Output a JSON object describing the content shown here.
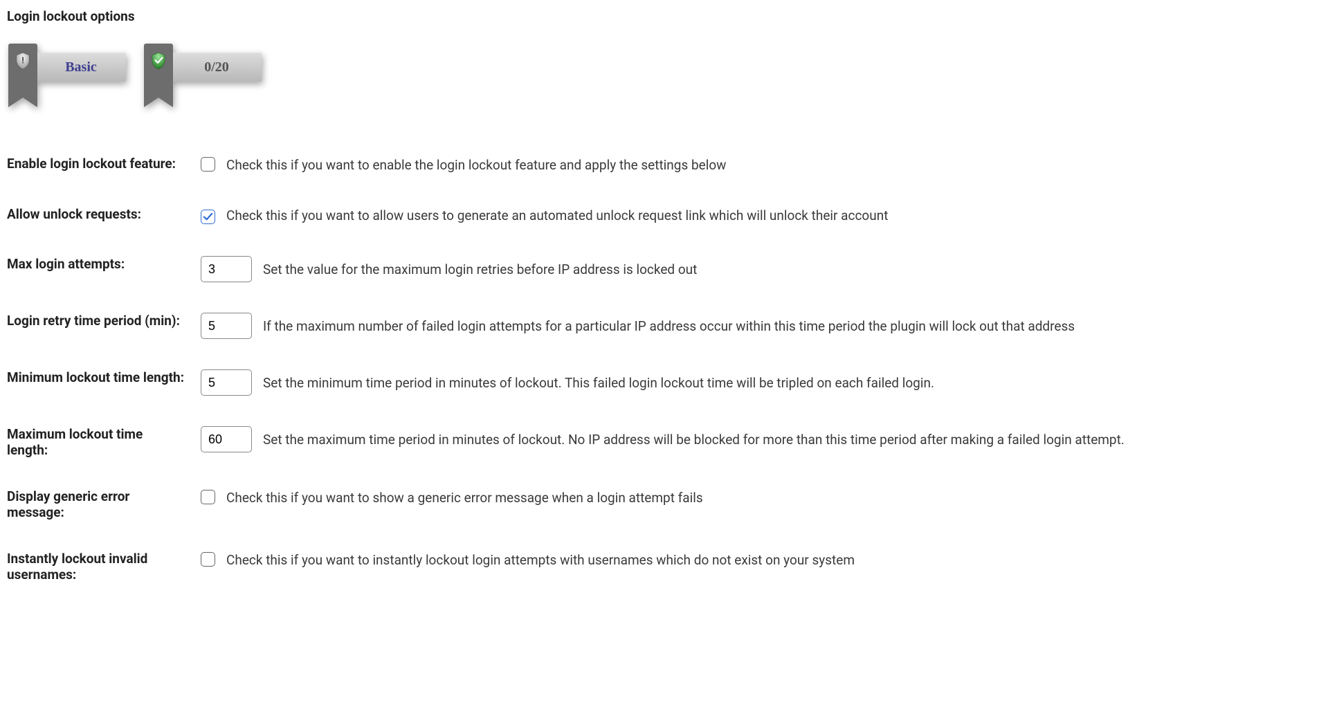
{
  "title": "Login lockout options",
  "badges": {
    "basic": "Basic",
    "score": "0/20"
  },
  "rows": {
    "enable": {
      "label": "Enable login lockout feature:",
      "checked": false,
      "desc": "Check this if you want to enable the login lockout feature and apply the settings below"
    },
    "allow_unlock": {
      "label": "Allow unlock requests:",
      "checked": true,
      "desc": "Check this if you want to allow users to generate an automated unlock request link which will unlock their account"
    },
    "max_attempts": {
      "label": "Max login attempts:",
      "value": "3",
      "desc": "Set the value for the maximum login retries before IP address is locked out"
    },
    "retry_period": {
      "label": "Login retry time period (min):",
      "value": "5",
      "desc": "If the maximum number of failed login attempts for a particular IP address occur within this time period the plugin will lock out that address"
    },
    "min_lockout": {
      "label": "Minimum lockout time length:",
      "value": "5",
      "desc": "Set the minimum time period in minutes of lockout. This failed login lockout time will be tripled on each failed login."
    },
    "max_lockout": {
      "label": "Maximum lockout time length:",
      "value": "60",
      "desc": "Set the maximum time period in minutes of lockout. No IP address will be blocked for more than this time period after making a failed login attempt."
    },
    "generic_error": {
      "label": "Display generic error message:",
      "checked": false,
      "desc": "Check this if you want to show a generic error message when a login attempt fails"
    },
    "instant_lockout": {
      "label": "Instantly lockout invalid usernames:",
      "checked": false,
      "desc": "Check this if you want to instantly lockout login attempts with usernames which do not exist on your system"
    }
  }
}
